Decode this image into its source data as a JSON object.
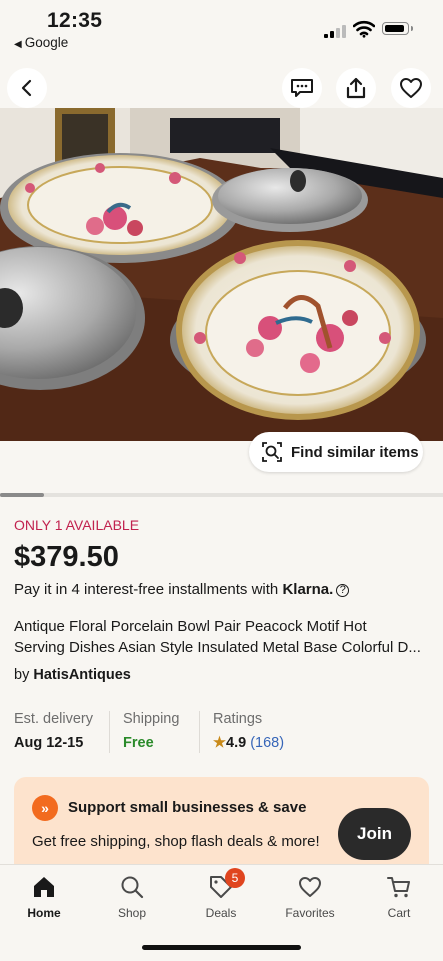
{
  "status_bar": {
    "time": "12:35",
    "back_app": "Google"
  },
  "listing": {
    "availability": "ONLY 1 AVAILABLE",
    "price": "$379.50",
    "installments_text": "Pay it in 4 interest-free installments with",
    "installments_provider": "Klarna.",
    "title_line1": "Antique Floral Porcelain Bowl Pair Peacock Motif Hot",
    "title_line2": "Serving Dishes Asian Style Insulated Metal Base Colorful D...",
    "seller_prefix": "by",
    "seller_name": "HatisAntiques",
    "image_progress": 0.1
  },
  "photo_actions": {
    "find_similar": "Find similar items"
  },
  "info": {
    "delivery_label": "Est. delivery",
    "delivery_value": "Aug 12-15",
    "shipping_label": "Shipping",
    "shipping_value": "Free",
    "ratings_label": "Ratings",
    "rating_value": "4.9",
    "rating_count": "(168)"
  },
  "promo": {
    "heading": "Support small businesses & save",
    "body": "Get free shipping, shop flash deals & more!",
    "join_label": "Join"
  },
  "tabs": [
    {
      "label": "Home",
      "icon": "home-icon"
    },
    {
      "label": "Shop",
      "icon": "search-icon"
    },
    {
      "label": "Deals",
      "icon": "tag-icon",
      "badge": "5"
    },
    {
      "label": "Favorites",
      "icon": "heart-icon"
    },
    {
      "label": "Cart",
      "icon": "cart-icon"
    }
  ],
  "colors": {
    "accent_red": "#c1224f",
    "free_green": "#2a8a2a",
    "link_blue": "#3665b8",
    "promo_bg": "#fde3cd",
    "promo_orange": "#f26b1f"
  }
}
